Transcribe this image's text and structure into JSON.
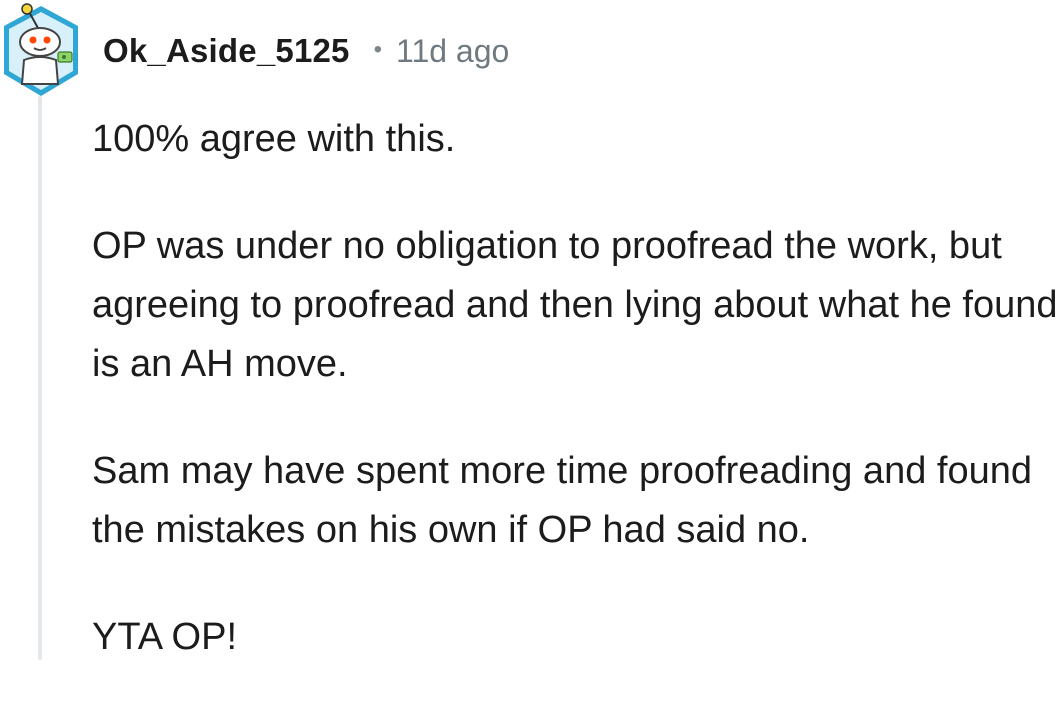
{
  "comment": {
    "author": "Ok_Aside_5125",
    "separator": "•",
    "timestamp": "11d ago",
    "avatar_icon": "reddit-snoo-avatar-icon",
    "paragraphs": [
      "100% agree with this.",
      "OP was under no obligation to proofread the work, but agreeing to proofread and then lying about what he found is an AH move.",
      "Sam may have spent more time proofreading and found the mistakes on his own if OP had said no.",
      "YTA OP!"
    ]
  },
  "colors": {
    "avatar_ring": "#2fa7d6",
    "avatar_bg": "#d8f0fa",
    "thread_line": "#e5e8ea",
    "text": "#1c1c1c",
    "meta": "#6f7a80"
  }
}
